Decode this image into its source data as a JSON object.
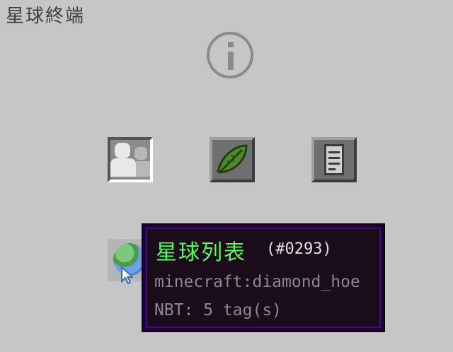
{
  "screen": {
    "title": "星球終端",
    "bottom_text": ""
  },
  "buttons": {
    "info": {
      "icon": "info-icon"
    },
    "players": {
      "icon": "people-icon"
    },
    "seed": {
      "icon": "leaf-icon"
    },
    "log": {
      "icon": "document-icon"
    }
  },
  "slot": {
    "item_icon": "planet-icon"
  },
  "tooltip": {
    "name": "星球列表",
    "id": "(#0293)",
    "registry": "minecraft:diamond_hoe",
    "nbt": "NBT: 5 tag(s)"
  },
  "colors": {
    "background": "#c6c6c6",
    "tooltip_title": "#55ff55",
    "tooltip_text": "#8a8a8a",
    "tooltip_border": "#3a0f7a"
  }
}
